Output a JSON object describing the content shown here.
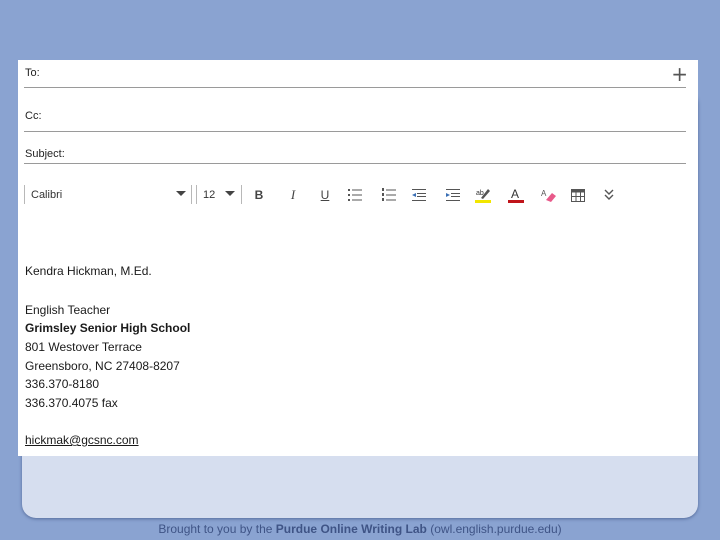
{
  "compose": {
    "to_label": "To:",
    "cc_label": "Cc:",
    "subject_label": "Subject:",
    "add_recipient": "+"
  },
  "toolbar": {
    "font_name": "Calibri",
    "font_size": "12",
    "bold": "B",
    "italic": "I",
    "underline": "U",
    "font_color_glyph": "A",
    "highlight_color": "#f2e600",
    "font_color": "#c0141a"
  },
  "signature": {
    "name": "Kendra Hickman, M.Ed.",
    "title": "English Teacher",
    "school": "Grimsley Senior High School",
    "street": "801 Westover Terrace",
    "city": "Greensboro, NC 27408-8207",
    "phone": "336.370-8180",
    "fax": "336.370.4075 fax",
    "email": "hickmak@gcsnc.com"
  },
  "footer": {
    "prefix": "Brought to you by the",
    "brand": "Purdue Online Writing Lab",
    "suffix": "(owl.english.purdue.edu)"
  }
}
